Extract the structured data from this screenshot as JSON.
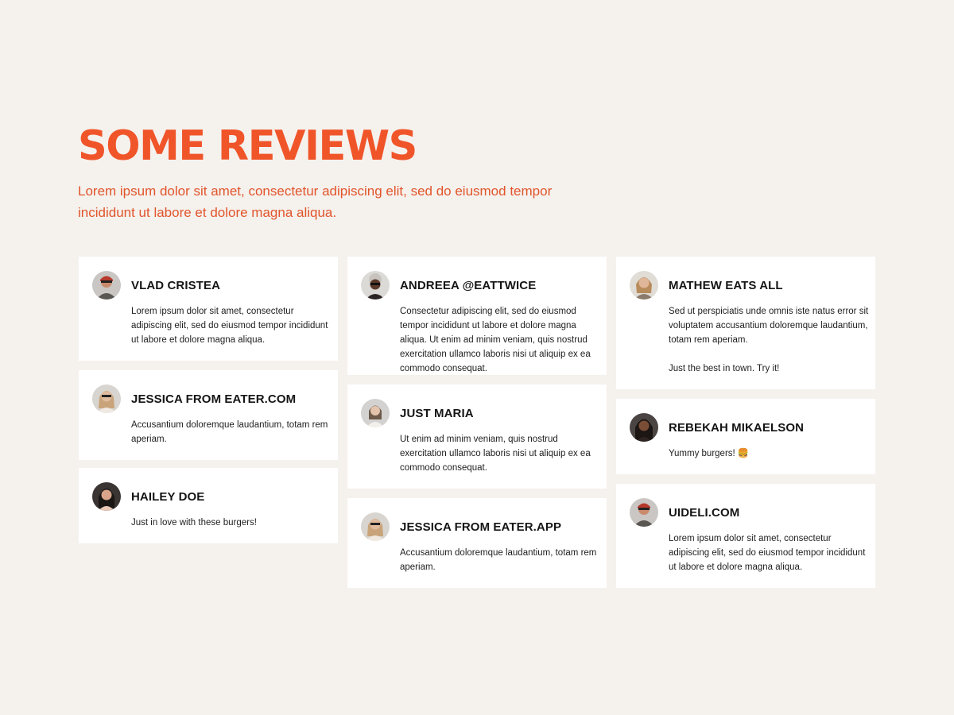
{
  "section": {
    "title": "SOME REVIEWS",
    "subtitle": "Lorem ipsum dolor sit amet, consectetur adipiscing elit, sed do eiusmod tempor incididunt ut labore et dolore magna aliqua."
  },
  "colors": {
    "accent": "#f0552a",
    "background": "#f5f1ed",
    "card": "#ffffff"
  },
  "reviews": [
    {
      "name": "VLAD CRISTEA",
      "text": "Lorem ipsum dolor sit amet, consectetur adipiscing elit, sed do eiusmod tempor incididunt ut labore et dolore magna aliqua.",
      "avatar": "avatar-photo"
    },
    {
      "name": "JESSICA FROM EATER.COM",
      "text": "Accusantium doloremque laudantium, totam rem aperiam.",
      "avatar": "avatar-photo"
    },
    {
      "name": "HAILEY DOE",
      "text": "Just in love with these burgers!",
      "avatar": "avatar-photo"
    },
    {
      "name": "ANDREEA @EATTWICE",
      "text": "Consectetur adipiscing elit, sed do eiusmod tempor incididunt ut labore et dolore magna aliqua. Ut enim ad minim veniam, quis nostrud exercitation ullamco laboris nisi ut aliquip ex ea commodo consequat.",
      "avatar": "avatar-photo"
    },
    {
      "name": "JUST MARIA",
      "text": "Ut enim ad minim veniam, quis nostrud exercitation ullamco laboris nisi ut aliquip ex ea commodo consequat.",
      "avatar": "avatar-photo"
    },
    {
      "name": "JESSICA FROM EATER.APP",
      "text": "Accusantium doloremque laudantium, totam rem aperiam.",
      "avatar": "avatar-photo"
    },
    {
      "name": "MATHEW EATS ALL",
      "text": "Sed ut perspiciatis unde omnis iste natus error sit voluptatem accusantium doloremque laudantium, totam rem aperiam.\n\nJust the best in town. Try it!",
      "avatar": "avatar-photo"
    },
    {
      "name": "REBEKAH MIKAELSON",
      "text": "Yummy burgers! 🍔",
      "avatar": "avatar-photo"
    },
    {
      "name": "UIDELI.COM",
      "text": "Lorem ipsum dolor sit amet, consectetur adipiscing elit, sed do eiusmod tempor incididunt ut labore et dolore magna aliqua.",
      "avatar": "avatar-photo"
    }
  ]
}
